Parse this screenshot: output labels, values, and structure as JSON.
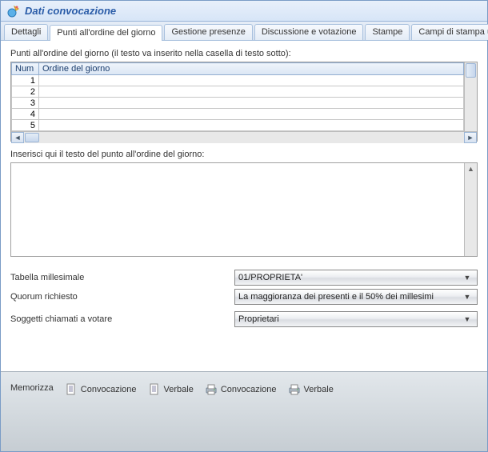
{
  "title": "Dati convocazione",
  "tabs": [
    {
      "label": "Dettagli",
      "active": false
    },
    {
      "label": "Punti all'ordine del giorno",
      "active": true
    },
    {
      "label": "Gestione presenze",
      "active": false
    },
    {
      "label": "Discussione e votazione",
      "active": false
    },
    {
      "label": "Stampe",
      "active": false
    },
    {
      "label": "Campi di stampa unione",
      "active": false
    }
  ],
  "grid": {
    "caption": "Punti all'ordine del giorno (il testo va inserito nella casella di testo sotto):",
    "columns": [
      "Num",
      "Ordine del giorno"
    ],
    "rows": [
      {
        "num": 1,
        "text": ""
      },
      {
        "num": 2,
        "text": ""
      },
      {
        "num": 3,
        "text": ""
      },
      {
        "num": 4,
        "text": ""
      },
      {
        "num": 5,
        "text": ""
      }
    ]
  },
  "textarea_label": "Inserisci qui il testo del punto all'ordine del giorno:",
  "form": {
    "tabella": {
      "label": "Tabella millesimale",
      "value": "01/PROPRIETA'"
    },
    "quorum": {
      "label": "Quorum richiesto",
      "value": "La maggioranza dei presenti e il 50% dei millesimi"
    },
    "soggetti": {
      "label": "Soggetti chiamati a votare",
      "value": "Proprietari"
    }
  },
  "toolbar": {
    "memorizza": "Memorizza",
    "convocazione_doc": "Convocazione",
    "verbale_doc": "Verbale",
    "convocazione_print": "Convocazione",
    "verbale_print": "Verbale"
  }
}
